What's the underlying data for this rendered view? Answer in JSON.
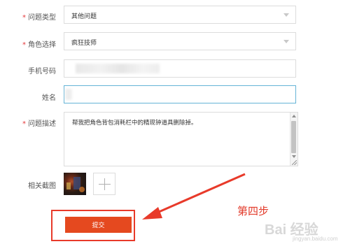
{
  "form": {
    "issue_type": {
      "label": "问题类型",
      "required": true,
      "value": "其他问题"
    },
    "role": {
      "label": "角色选择",
      "required": true,
      "value": "疯狂技师"
    },
    "phone": {
      "label": "手机号码",
      "required": false,
      "value": ""
    },
    "name": {
      "label": "姓名",
      "required": false,
      "value": ""
    },
    "description": {
      "label": "问题描述",
      "required": true,
      "value": "帮我把角色背包消耗栏中的精现钟道具删除掉。"
    },
    "screenshots": {
      "label": "相关截图"
    },
    "submit_label": "提交"
  },
  "annotation": {
    "text": "第四步",
    "color": "#e23a2a"
  },
  "watermark": {
    "text": "Bai 经验",
    "sub": "jingyan.baidu.com"
  },
  "colors": {
    "accent": "#e5491f",
    "required": "#e4393c",
    "focus_border": "#64b3d6"
  }
}
